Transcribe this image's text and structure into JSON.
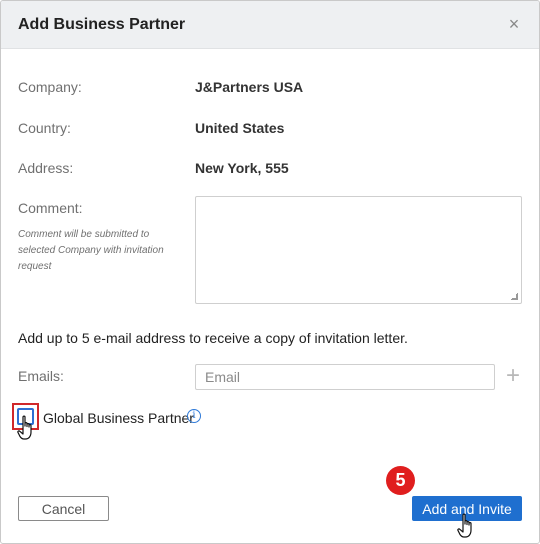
{
  "dialog": {
    "title": "Add Business Partner",
    "close_icon": "close-icon",
    "close_symbol": "×"
  },
  "fields": {
    "company_label": "Company:",
    "company_value": "J&Partners USA",
    "country_label": "Country:",
    "country_value": "United States",
    "address_label": "Address:",
    "address_value": "New York, 555",
    "comment_label": "Comment:",
    "comment_hint": "Comment will be submitted to selected Company with invitation request",
    "comment_value": ""
  },
  "emails": {
    "info_text": "Add up to 5 e-mail address to receive a copy of invitation letter.",
    "label": "Emails:",
    "placeholder": "Email",
    "value": "",
    "add_icon": "plus-icon",
    "add_symbol": "+"
  },
  "global_partner": {
    "label": "Global Business Partner",
    "checked": false,
    "info_icon": "info-icon",
    "info_symbol": "i"
  },
  "actions": {
    "cancel_label": "Cancel",
    "submit_label": "Add and Invite"
  },
  "annotation": {
    "step_number": "5"
  },
  "colors": {
    "primary": "#1f6fcf",
    "highlight": "#d0282a",
    "badge": "#e01e1e",
    "header_bg": "#eef0f2"
  }
}
